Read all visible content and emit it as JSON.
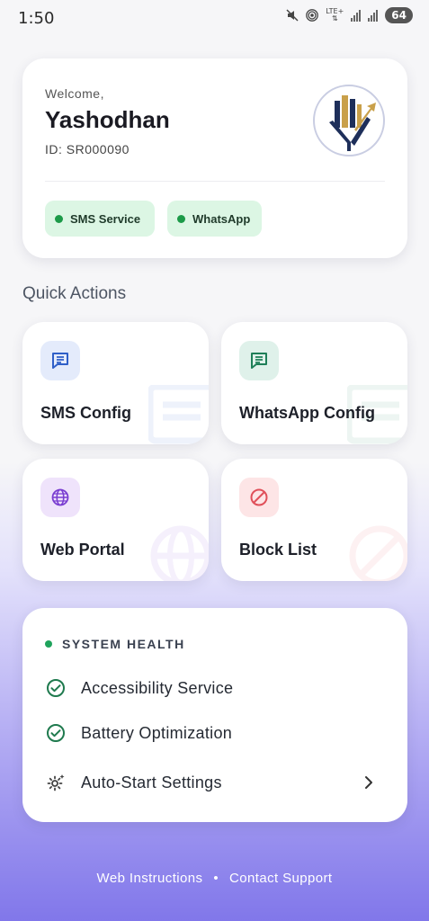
{
  "status_bar": {
    "time": "1:50",
    "network": "LTE+",
    "battery": "64"
  },
  "profile": {
    "welcome": "Welcome,",
    "name": "Yashodhan",
    "id": "ID: SR000090",
    "services": [
      {
        "label": "SMS Service",
        "status_color": "#1c9a48"
      },
      {
        "label": "WhatsApp",
        "status_color": "#1c9a48"
      }
    ]
  },
  "quick_actions": {
    "title": "Quick Actions",
    "items": [
      {
        "label": "SMS Config",
        "icon": "message-icon",
        "color": "#2f5fc8"
      },
      {
        "label": "WhatsApp Config",
        "icon": "message-icon",
        "color": "#1e7f58"
      },
      {
        "label": "Web Portal",
        "icon": "globe-icon",
        "color": "#7a3ed1"
      },
      {
        "label": "Block List",
        "icon": "block-icon",
        "color": "#e0505a"
      }
    ]
  },
  "system_health": {
    "title": "SYSTEM HEALTH",
    "items": [
      {
        "label": "Accessibility Service",
        "icon": "check-circle-icon"
      },
      {
        "label": "Battery Optimization",
        "icon": "check-circle-icon"
      },
      {
        "label": "Auto-Start Settings",
        "icon": "gear-icon"
      }
    ]
  },
  "footer": {
    "instructions": "Web Instructions",
    "separator": "•",
    "support": "Contact Support"
  }
}
